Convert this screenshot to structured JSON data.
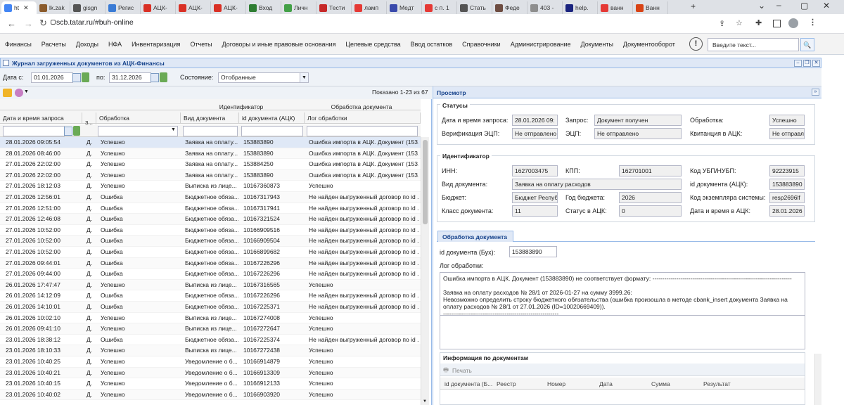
{
  "browser": {
    "tabs": [
      {
        "label": "ht",
        "active": true,
        "color": "#4285f4"
      },
      {
        "label": "lk.zak",
        "color": "#8a5a2b"
      },
      {
        "label": "gisgn",
        "color": "#555555"
      },
      {
        "label": "Регис",
        "color": "#3a7bd5"
      },
      {
        "label": "АЦК-",
        "color": "#d93025"
      },
      {
        "label": "АЦК-",
        "color": "#d93025"
      },
      {
        "label": "АЦК-",
        "color": "#d93025"
      },
      {
        "label": "Вход",
        "color": "#2e7d32"
      },
      {
        "label": "Личн",
        "color": "#43a047"
      },
      {
        "label": "Тести",
        "color": "#c62828"
      },
      {
        "label": "ламп",
        "color": "#e53935"
      },
      {
        "label": "Медт",
        "color": "#3949ab"
      },
      {
        "label": "с п. 1",
        "color": "#e53935"
      },
      {
        "label": "Стать",
        "color": "#555555"
      },
      {
        "label": "Феде",
        "color": "#6d4c41"
      },
      {
        "label": "403 -",
        "color": "#8e8e8e"
      },
      {
        "label": "help.",
        "color": "#1a237e"
      },
      {
        "label": "ванн",
        "color": "#e53935"
      },
      {
        "label": "Ванн",
        "color": "#d84315"
      }
    ],
    "new_tab": "+",
    "url": "scb.tatar.ru/#buh-online"
  },
  "menu": {
    "items": [
      "Финансы",
      "Расчеты",
      "Доходы",
      "НФА",
      "Инвентаризация",
      "Отчеты",
      "Договоры и иные правовые основания",
      "Целевые средства",
      "Ввод остатков",
      "Справочники",
      "Администрирование",
      "Документы",
      "Документооборот"
    ],
    "search_placeholder": "Введите текст...",
    "bell_text": "!"
  },
  "panel": {
    "title": "Журнал загруженных документов из АЦК-Финансы"
  },
  "filters": {
    "date_from_label": "Дата с:",
    "date_from": "01.01.2026",
    "date_to_label": "по:",
    "date_to": "31.12.2026",
    "state_label": "Состояние:",
    "state_value": "Отобранные"
  },
  "grid": {
    "shown": "Показано 1-23 из 67",
    "group_identifier": "Идентификатор",
    "group_processing": "Обработка документа",
    "col_date": "Дата и время запроса",
    "col_z": "З...",
    "col_status": "Обработка",
    "col_type": "Вид документа",
    "col_id": "id документа (АЦК)",
    "col_log": "Лог обработки",
    "rows": [
      {
        "date": "28.01.2026 09:05:54",
        "z": "Д.",
        "st": "Успешно",
        "type": "Заявка на оплату...",
        "id": "153883890",
        "log": "Ошибка импорта в АЦК. Документ (153..."
      },
      {
        "date": "28.01.2026 08:46:00",
        "z": "Д.",
        "st": "Успешно",
        "type": "Заявка на оплату...",
        "id": "153883890",
        "log": "Ошибка импорта в АЦК. Документ (153..."
      },
      {
        "date": "27.01.2026 22:02:00",
        "z": "Д.",
        "st": "Успешно",
        "type": "Заявка на оплату...",
        "id": "153884250",
        "log": "Ошибка импорта в АЦК. Документ (153..."
      },
      {
        "date": "27.01.2026 22:02:00",
        "z": "Д.",
        "st": "Успешно",
        "type": "Заявка на оплату...",
        "id": "153883890",
        "log": "Ошибка импорта в АЦК. Документ (153..."
      },
      {
        "date": "27.01.2026 18:12:03",
        "z": "Д.",
        "st": "Успешно",
        "type": "Выписка из лице...",
        "id": "10167360873",
        "log": "Успешно"
      },
      {
        "date": "27.01.2026 12:56:01",
        "z": "Д.",
        "st": "Ошибка",
        "type": "Бюджетное обяза...",
        "id": "10167317943",
        "log": "Не найден выгруженный договор по id ..."
      },
      {
        "date": "27.01.2026 12:51:00",
        "z": "Д.",
        "st": "Ошибка",
        "type": "Бюджетное обяза...",
        "id": "10167317941",
        "log": "Не найден выгруженный договор по id ..."
      },
      {
        "date": "27.01.2026 12:46:08",
        "z": "Д.",
        "st": "Ошибка",
        "type": "Бюджетное обяза...",
        "id": "10167321524",
        "log": "Не найден выгруженный договор по id ..."
      },
      {
        "date": "27.01.2026 10:52:00",
        "z": "Д.",
        "st": "Ошибка",
        "type": "Бюджетное обяза...",
        "id": "10166909516",
        "log": "Не найден выгруженный договор по id ..."
      },
      {
        "date": "27.01.2026 10:52:00",
        "z": "Д.",
        "st": "Ошибка",
        "type": "Бюджетное обяза...",
        "id": "10166909504",
        "log": "Не найден выгруженный договор по id ..."
      },
      {
        "date": "27.01.2026 10:52:00",
        "z": "Д.",
        "st": "Ошибка",
        "type": "Бюджетное обяза...",
        "id": "10166899682",
        "log": "Не найден выгруженный договор по id ..."
      },
      {
        "date": "27.01.2026 09:44:01",
        "z": "Д.",
        "st": "Ошибка",
        "type": "Бюджетное обяза...",
        "id": "10167226296",
        "log": "Не найден выгруженный договор по id ..."
      },
      {
        "date": "27.01.2026 09:44:00",
        "z": "Д.",
        "st": "Ошибка",
        "type": "Бюджетное обяза...",
        "id": "10167226296",
        "log": "Не найден выгруженный договор по id ..."
      },
      {
        "date": "26.01.2026 17:47:47",
        "z": "Д.",
        "st": "Успешно",
        "type": "Выписка из лице...",
        "id": "10167316565",
        "log": "Успешно"
      },
      {
        "date": "26.01.2026 14:12:09",
        "z": "Д.",
        "st": "Ошибка",
        "type": "Бюджетное обяза...",
        "id": "10167226296",
        "log": "Не найден выгруженный договор по id ..."
      },
      {
        "date": "26.01.2026 14:10:01",
        "z": "Д.",
        "st": "Ошибка",
        "type": "Бюджетное обяза...",
        "id": "10167225371",
        "log": "Не найден выгруженный договор по id ..."
      },
      {
        "date": "26.01.2026 10:02:10",
        "z": "Д.",
        "st": "Успешно",
        "type": "Выписка из лице...",
        "id": "10167274008",
        "log": "Успешно"
      },
      {
        "date": "26.01.2026 09:41:10",
        "z": "Д.",
        "st": "Успешно",
        "type": "Выписка из лице...",
        "id": "10167272647",
        "log": "Успешно"
      },
      {
        "date": "23.01.2026 18:38:12",
        "z": "Д.",
        "st": "Ошибка",
        "type": "Бюджетное обяза...",
        "id": "10167225374",
        "log": "Не найден выгруженный договор по id ..."
      },
      {
        "date": "23.01.2026 18:10:33",
        "z": "Д.",
        "st": "Успешно",
        "type": "Выписка из лице...",
        "id": "10167272438",
        "log": "Успешно"
      },
      {
        "date": "23.01.2026 10:40:25",
        "z": "Д.",
        "st": "Успешно",
        "type": "Уведомление о б...",
        "id": "10166914879",
        "log": "Успешно"
      },
      {
        "date": "23.01.2026 10:40:21",
        "z": "Д.",
        "st": "Успешно",
        "type": "Уведомление о б...",
        "id": "10166913309",
        "log": "Успешно"
      },
      {
        "date": "23.01.2026 10:40:15",
        "z": "Д.",
        "st": "Успешно",
        "type": "Уведомление о б...",
        "id": "10166912133",
        "log": "Успешно"
      },
      {
        "date": "23.01.2026 10:40:02",
        "z": "Д.",
        "st": "Успешно",
        "type": "Уведомление о б...",
        "id": "10166903920",
        "log": "Успешно"
      }
    ]
  },
  "preview": {
    "title": "Просмотр",
    "statuses_title": "Статусы",
    "req_label": "Дата и время запроса:",
    "req_value": "28.01.2026 09:",
    "zapros_label": "Запрос:",
    "zapros_value": "Документ получен",
    "obr_label": "Обработка:",
    "obr_value": "Успешно",
    "verif_label": "Верификация ЭЦП:",
    "verif_value": "Не отправлено",
    "ecp_label": "ЭЦП:",
    "ecp_value": "Не отправлено",
    "kvit_label": "Квитанция в АЦК:",
    "kvit_value": "Не отправлено",
    "ident_title": "Идентификатор",
    "inn_label": "ИНН:",
    "inn_value": "1627003475",
    "kpp_label": "КПП:",
    "kpp_value": "162701001",
    "ubp_label": "Код УБП/НУБП:",
    "ubp_value": "92223915",
    "vid_label": "Вид документа:",
    "vid_value": "Заявка на оплату расходов",
    "idacc_label": "id документа (АЦК):",
    "idacc_value": "153883890",
    "budget_label": "Бюджет:",
    "budget_value": "Бюджет Республики",
    "year_label": "Год бюджета:",
    "year_value": "2026",
    "codesys_label": "Код экземпляра системы:",
    "codesys_value": "resp2696lf",
    "class_label": "Класс документа:",
    "class_value": "11",
    "statacc_label": "Статус в АЦК:",
    "statacc_value": "0",
    "dtacc_label": "Дата и время в АЦК:",
    "dtacc_value": "28.01.2026",
    "tab_label": "Обработка документа",
    "idbuh_label": "id документа (Бух):",
    "idbuh_value": "153883890",
    "log_label": "Лог обработки:",
    "log_text": "Ошибка импорта в АЦК. Документ (153883890) не соответствует формату: ----------------------------------------------------------------------\n\nЗаявка на оплату расходов № 28/1 от 2026-01-27 на сумму 3999.26:\nНевозможно определить строку бюджетного обязательства (ошибка произошла в методе cbank_insert документа Заявка на оплату расходов № 28/1 от 27.01.2026 (ID=10020669409)).\n----------------------------------------------------------",
    "info_title": "Информация по документам",
    "print_label": "Печать",
    "cols": [
      "id документа (Б...",
      "Реестр",
      "Номер",
      "Дата",
      "Сумма",
      "Результат"
    ]
  }
}
